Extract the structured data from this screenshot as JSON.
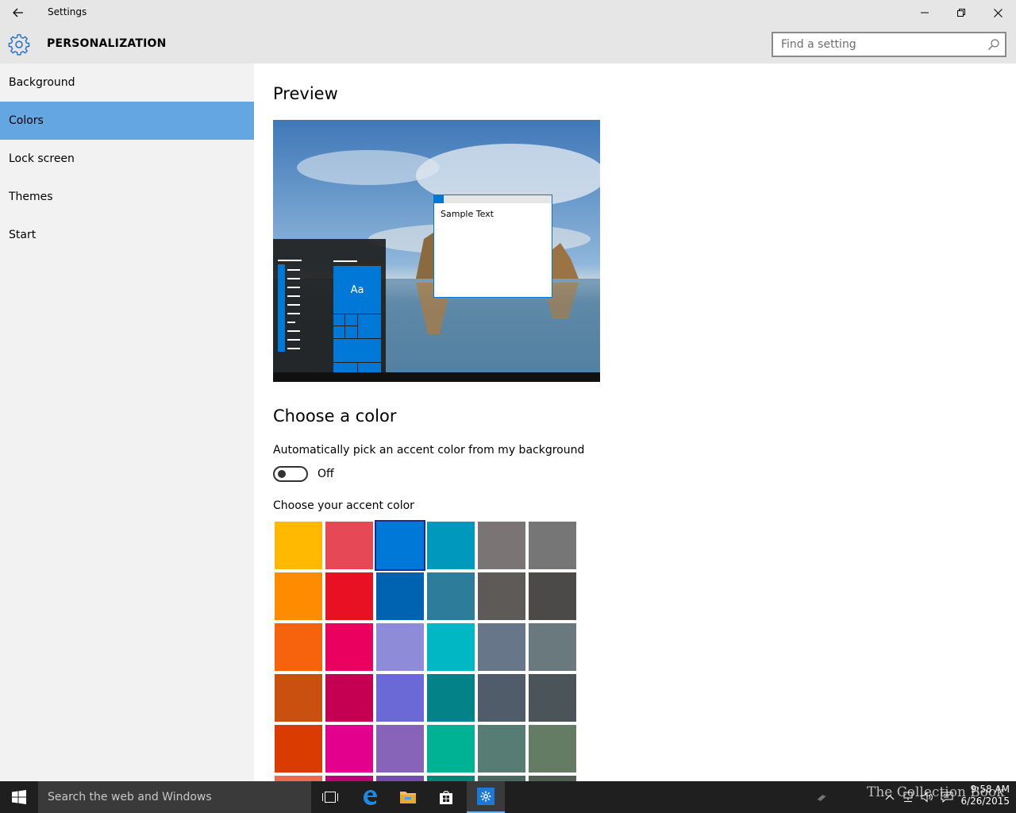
{
  "titlebar": {
    "title": "Settings"
  },
  "header": {
    "title": "PERSONALIZATION"
  },
  "search": {
    "placeholder": "Find a setting"
  },
  "sidebar": {
    "items": [
      {
        "label": "Background",
        "active": false
      },
      {
        "label": "Colors",
        "active": true
      },
      {
        "label": "Lock screen",
        "active": false
      },
      {
        "label": "Themes",
        "active": false
      },
      {
        "label": "Start",
        "active": false
      }
    ]
  },
  "main": {
    "preview_heading": "Preview",
    "preview": {
      "sample_text": "Sample Text",
      "tile_label": "Aa"
    },
    "choose_heading": "Choose a color",
    "auto_pick_label": "Automatically pick an accent color from my background",
    "auto_pick_state": "Off",
    "accent_label": "Choose your accent color",
    "accent_colors": [
      [
        "#ffb900",
        "#e74856",
        "#0078d7",
        "#0099bc",
        "#7a7574",
        "#767676"
      ],
      [
        "#ff8c00",
        "#e81123",
        "#0063b1",
        "#2d7d9a",
        "#5d5a58",
        "#4c4a48"
      ],
      [
        "#f7630c",
        "#ea005e",
        "#8e8cd8",
        "#00b7c3",
        "#68768a",
        "#69797e"
      ],
      [
        "#ca5010",
        "#c30052",
        "#6b69d6",
        "#038387",
        "#515c6b",
        "#4a5459"
      ],
      [
        "#da3b01",
        "#e3008c",
        "#8764b8",
        "#00b294",
        "#567c73",
        "#647c64"
      ],
      [
        "#ef6950",
        "#bf0077",
        "#744da9",
        "#018574",
        "#486860",
        "#525e54"
      ]
    ],
    "selected_accent": "#0078d7"
  },
  "taskbar": {
    "search_placeholder": "Search the web and Windows",
    "time": "9:58 AM",
    "date": "6/26/2015",
    "watermark": "The Collection Book"
  }
}
